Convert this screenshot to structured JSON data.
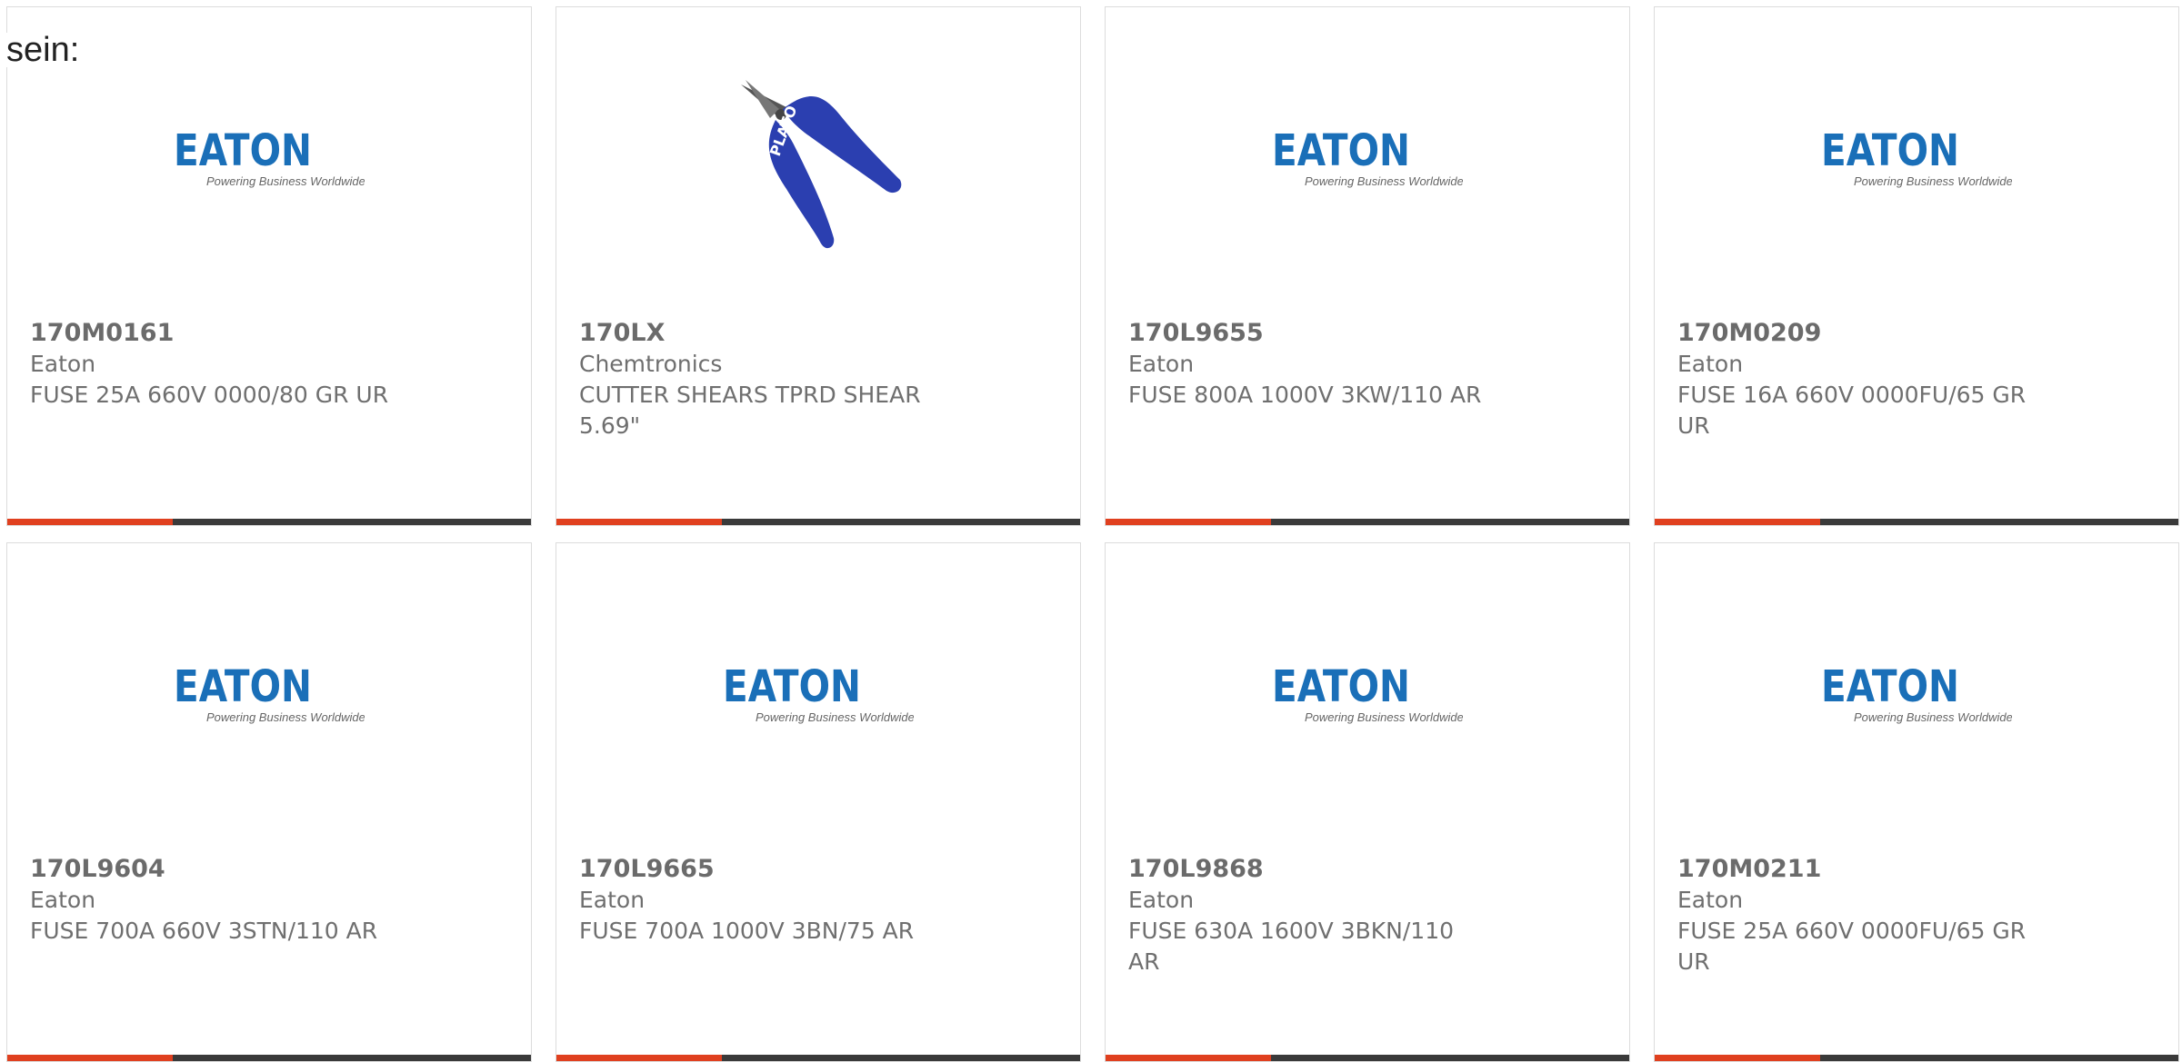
{
  "intro_text": "sein:",
  "colors": {
    "accent": "#e0401f",
    "bar": "#3a3a3a",
    "eaton_blue": "#1a6fb8",
    "text": "#6f6f6f"
  },
  "products": [
    {
      "part_number": "170M0161",
      "manufacturer": "Eaton",
      "description": "FUSE 25A 660V 0000/80 GR UR",
      "image": "eaton-logo",
      "logo_word": "EATON",
      "logo_tagline": "Powering Business Worldwide"
    },
    {
      "part_number": "170LX",
      "manufacturer": "Chemtronics",
      "description": "CUTTER SHEARS TPRD SHEAR 5.69\"",
      "image": "cutter-tool",
      "logo_word": "PLATO",
      "logo_tagline": ""
    },
    {
      "part_number": "170L9655",
      "manufacturer": "Eaton",
      "description": "FUSE 800A 1000V 3KW/110 AR",
      "image": "eaton-logo",
      "logo_word": "EATON",
      "logo_tagline": "Powering Business Worldwide"
    },
    {
      "part_number": "170M0209",
      "manufacturer": "Eaton",
      "description": "FUSE 16A 660V 0000FU/65 GR UR",
      "image": "eaton-logo",
      "logo_word": "EATON",
      "logo_tagline": "Powering Business Worldwide"
    },
    {
      "part_number": "170L9604",
      "manufacturer": "Eaton",
      "description": "FUSE 700A 660V 3STN/110 AR",
      "image": "eaton-logo",
      "logo_word": "EATON",
      "logo_tagline": "Powering Business Worldwide"
    },
    {
      "part_number": "170L9665",
      "manufacturer": "Eaton",
      "description": "FUSE 700A 1000V 3BN/75 AR",
      "image": "eaton-logo",
      "logo_word": "EATON",
      "logo_tagline": "Powering Business Worldwide"
    },
    {
      "part_number": "170L9868",
      "manufacturer": "Eaton",
      "description": "FUSE 630A 1600V 3BKN/110 AR",
      "image": "eaton-logo",
      "logo_word": "EATON",
      "logo_tagline": "Powering Business Worldwide"
    },
    {
      "part_number": "170M0211",
      "manufacturer": "Eaton",
      "description": "FUSE 25A 660V 0000FU/65 GR UR",
      "image": "eaton-logo",
      "logo_word": "EATON",
      "logo_tagline": "Powering Business Worldwide"
    }
  ]
}
